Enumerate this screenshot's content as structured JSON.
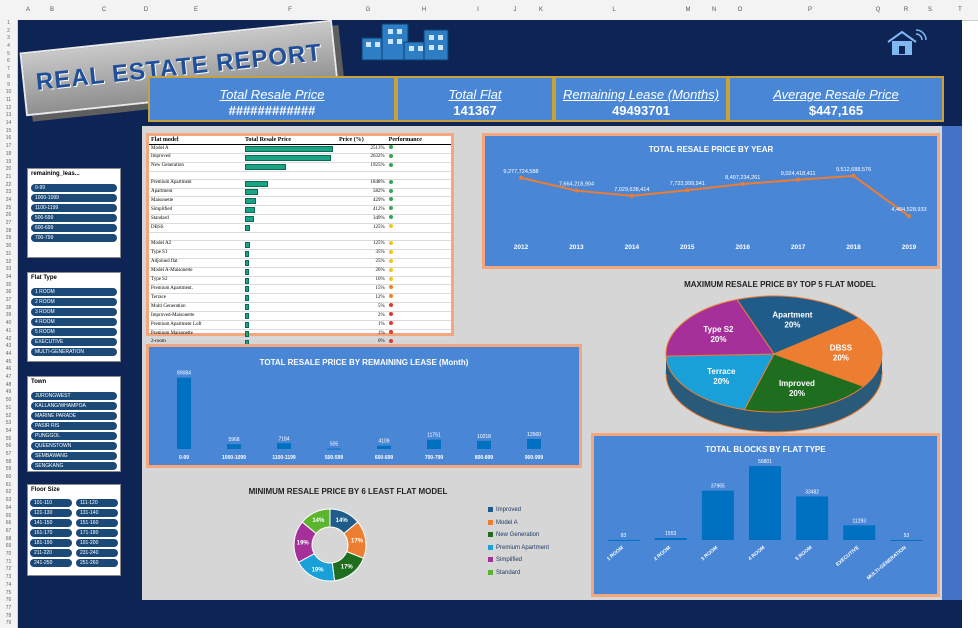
{
  "sheet": {
    "columns": [
      "A",
      "B",
      "C",
      "D",
      "E",
      "F",
      "G",
      "H",
      "I",
      "J",
      "K",
      "L",
      "M",
      "N",
      "O",
      "P",
      "Q",
      "R",
      "S",
      "T"
    ],
    "rows_start": 1,
    "rows_end": 79
  },
  "title": "REAL ESTATE REPORT",
  "kpis": {
    "total_resale_price": {
      "label": "Total Resale Price",
      "value": "############"
    },
    "total_flat": {
      "label": "Total Flat",
      "value": "141367"
    },
    "remaining_lease": {
      "label": "Remaining Lease (Months)",
      "value": "49493701"
    },
    "average_resale_price": {
      "label": "Average Resale Price",
      "value": "$447,165"
    }
  },
  "slicers": {
    "remaining_lease": {
      "header": "remaining_leas...",
      "options": [
        "0-99",
        "1000-1099",
        "1100-1199",
        "500-599",
        "600-699",
        "700-799"
      ]
    },
    "flat_type": {
      "header": "Flat Type",
      "options": [
        "1 ROOM",
        "2 ROOM",
        "3 ROOM",
        "4 ROOM",
        "5 ROOM",
        "EXECUTIVE",
        "MULTI-GENERATION"
      ]
    },
    "town": {
      "header": "Town",
      "options": [
        "JURONGWEST",
        "KALLANG/WHAMPOA",
        "MARINE PARADE",
        "PASIR RIS",
        "PUNGGOL",
        "QUEENSTOWN",
        "SEMBAWANG",
        "SENGKANG"
      ]
    },
    "floor_size": {
      "header": "Floor Size",
      "options": [
        "101-110",
        "111-120",
        "121-130",
        "131-140",
        "141-150",
        "151-160",
        "161-170",
        "171-180",
        "181-190",
        "191-200",
        "211-220",
        "231-240",
        "241-250",
        "251-260"
      ]
    }
  },
  "table": {
    "headers": [
      "Flat model",
      "Total Resale Price",
      "Price (%)",
      "Performance"
    ],
    "rows": [
      {
        "model": "Model A",
        "pct": "2513%",
        "bar": 1.0,
        "status": "green"
      },
      {
        "model": "Improved",
        "pct": "2632%",
        "bar": 0.98,
        "status": "green"
      },
      {
        "model": "New Generation",
        "pct": "1925%",
        "bar": 0.45,
        "status": "green"
      },
      {
        "model": "",
        "pct": "",
        "bar": 0,
        "status": ""
      },
      {
        "model": "Premium Apartment",
        "pct": "1848%",
        "bar": 0.24,
        "status": "green"
      },
      {
        "model": "Apartment",
        "pct": "582%",
        "bar": 0.13,
        "status": "green"
      },
      {
        "model": "Maisonette",
        "pct": "429%",
        "bar": 0.1,
        "status": "green"
      },
      {
        "model": "Simplified",
        "pct": "412%",
        "bar": 0.09,
        "status": "green"
      },
      {
        "model": "Standard",
        "pct": "349%",
        "bar": 0.08,
        "status": "green"
      },
      {
        "model": "DBSS",
        "pct": "125%",
        "bar": 0.03,
        "status": "yellow"
      },
      {
        "model": "",
        "pct": "",
        "bar": 0,
        "status": ""
      },
      {
        "model": "Model A2",
        "pct": "125%",
        "bar": 0.03,
        "status": "yellow"
      },
      {
        "model": "Type S1",
        "pct": "35%",
        "bar": 0.01,
        "status": "yellow"
      },
      {
        "model": "Adjoined flat",
        "pct": "25%",
        "bar": 0.01,
        "status": "yellow"
      },
      {
        "model": "Model A-Maisonette",
        "pct": "26%",
        "bar": 0.01,
        "status": "yellow"
      },
      {
        "model": "Type S2",
        "pct": "16%",
        "bar": 0.005,
        "status": "yellow"
      },
      {
        "model": "Premium Apartment.",
        "pct": "15%",
        "bar": 0.005,
        "status": "orange"
      },
      {
        "model": "Terrace",
        "pct": "12%",
        "bar": 0.004,
        "status": "orange"
      },
      {
        "model": "Multi Generation",
        "pct": "5%",
        "bar": 0.002,
        "status": "red"
      },
      {
        "model": "Improved-Maisonette",
        "pct": "2%",
        "bar": 0.001,
        "status": "red"
      },
      {
        "model": "Premium Apartment Loft",
        "pct": "1%",
        "bar": 0.001,
        "status": "red"
      },
      {
        "model": "Premium Maisonette",
        "pct": "1%",
        "bar": 0.001,
        "status": "red"
      },
      {
        "model": "2-room",
        "pct": "0%",
        "bar": 0,
        "status": "red"
      }
    ]
  },
  "colors": {
    "navy": "#0d2455",
    "panel_blue": "#4a86d6",
    "accent_orange": "#f4a67e",
    "bar_blue": "#0070c0",
    "line_orange": "#ed7d31",
    "status_green": "#34a853",
    "status_yellow": "#f5c518",
    "status_orange": "#f58220",
    "status_red": "#e03a2c"
  },
  "chart_data": [
    {
      "id": "year",
      "type": "line",
      "title": "TOTAL RESALE PRICE BY YEAR",
      "x": [
        "2012",
        "2013",
        "2014",
        "2015",
        "2016",
        "2017",
        "2018",
        "2019"
      ],
      "y": [
        9277724588,
        7664218904,
        7029638414,
        7723999941,
        8497234261,
        9024418411,
        9512688576,
        4484528933
      ],
      "labels": [
        "9,277,724,588",
        "7,664,218,904",
        "7,029,638,414",
        "7,723,999,941",
        "8,497,234,261",
        "9,024,418,411",
        "9,512,688,576",
        "4,484,528,933"
      ],
      "ylim": [
        3000000000,
        11000000000
      ]
    },
    {
      "id": "lease",
      "type": "bar",
      "title": "TOTAL RESALE PRICE BY REMAINING LEASE (Month)",
      "categories": [
        "0-99",
        "1000-1099",
        "1100-1199",
        "500-599",
        "600-699",
        "700-799",
        "800-899",
        "900-999"
      ],
      "values": [
        89084,
        5968,
        7184,
        505,
        4109,
        11751,
        10218,
        12560
      ],
      "ylim": [
        0,
        95000
      ]
    },
    {
      "id": "top5",
      "type": "pie",
      "title": "MAXIMUM RESALE PRICE BY TOP 5 FLAT MODEL",
      "labels": [
        "Apartment",
        "DBSS",
        "Improved",
        "Terrace",
        "Type S2"
      ],
      "values": [
        20,
        20,
        20,
        20,
        20
      ],
      "display": [
        "20%",
        "20%",
        "20%",
        "20%",
        "20%"
      ],
      "colors": [
        "#1f5c8a",
        "#ed7d31",
        "#1f6e1f",
        "#1aa0d8",
        "#a5309a"
      ]
    },
    {
      "id": "least6",
      "type": "pie",
      "title": "MINIMUM  RESALE PRICE BY 6 LEAST FLAT MODEL",
      "labels": [
        "Improved",
        "Model A",
        "New Generation",
        "Premium Apartment",
        "Simplified",
        "Standard"
      ],
      "values": [
        14,
        17,
        17,
        19,
        19,
        14
      ],
      "display": [
        "14%",
        "17%",
        "17%",
        "19%",
        "19%",
        "14%"
      ],
      "colors": [
        "#1f5c8a",
        "#ed7d31",
        "#1f6e1f",
        "#1aa0d8",
        "#a5309a",
        "#5cb52f"
      ]
    },
    {
      "id": "blocks",
      "type": "bar",
      "title": "TOTAL BLOCKS BY FLAT TYPE",
      "categories": [
        "1 ROOM",
        "2 ROOM",
        "3 ROOM",
        "4 ROOM",
        "5 ROOM",
        "EXECUTIVE",
        "MULTI-GENERATION"
      ],
      "values": [
        83,
        1553,
        37965,
        56801,
        33482,
        11293,
        53
      ],
      "ylim": [
        0,
        60000
      ]
    }
  ]
}
